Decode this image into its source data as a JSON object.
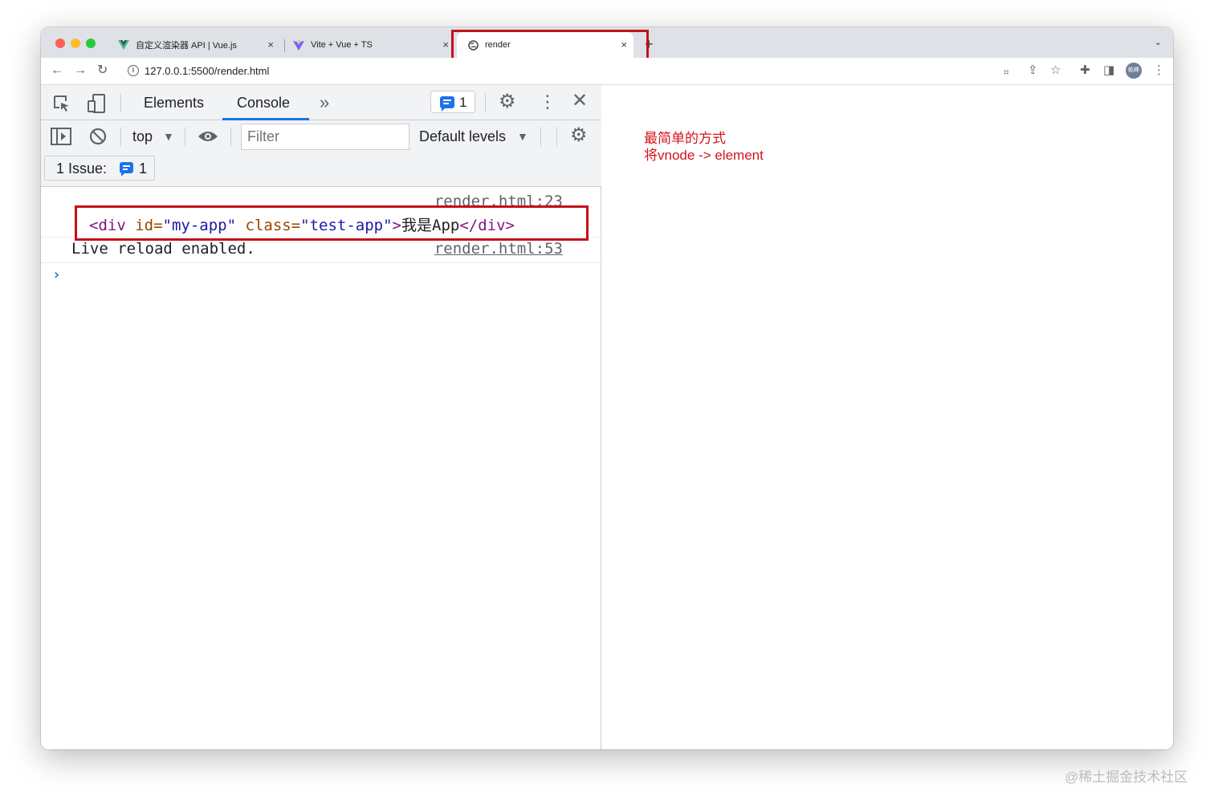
{
  "browser": {
    "tabs": [
      {
        "title": "自定义渲染器 API | Vue.js",
        "close": "×"
      },
      {
        "title": "Vite + Vue + TS",
        "close": "×"
      },
      {
        "title": "render",
        "close": "×"
      }
    ],
    "new_tab": "+",
    "tab_menu": "⌄",
    "url": "127.0.0.1:5500/render.html",
    "avatar_text": "乾峰"
  },
  "devtools": {
    "tabs": {
      "elements": "Elements",
      "console": "Console",
      "more": "»"
    },
    "issues_badge_count": "1",
    "context": "top",
    "context_arrow": "▼",
    "filter_placeholder": "Filter",
    "levels": "Default levels",
    "levels_arrow": "▼",
    "issues": {
      "label": "1 Issue:",
      "count": "1"
    },
    "console": {
      "entries": [
        {
          "source": "render.html:23",
          "tag_open": "<div",
          "attr1": "id=",
          "val1": "\"my-app\"",
          "attr2": "class=",
          "val2": "\"test-app\"",
          "tag_gt": ">",
          "text": "我是App",
          "tag_close": "</div>"
        },
        {
          "message": "Live reload enabled.",
          "source": "render.html:53"
        }
      ],
      "prompt": "›"
    }
  },
  "page": {
    "line1": "最简单的方式",
    "line2": "将vnode -> element"
  },
  "watermark": "@稀土掘金技术社区",
  "colors": {
    "annotation_red": "#c4101b",
    "accent": "#1a73e8"
  }
}
